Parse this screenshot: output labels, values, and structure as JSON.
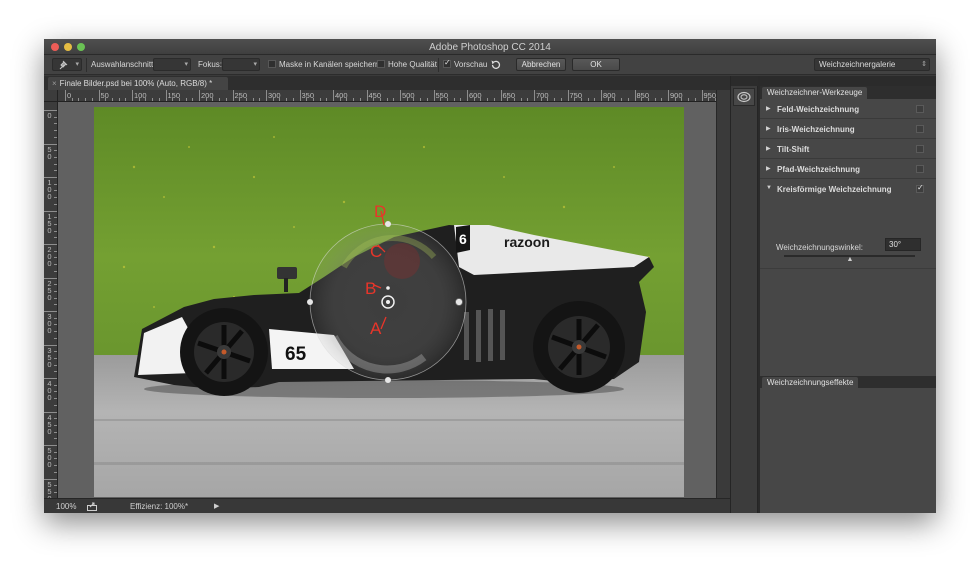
{
  "window": {
    "title": "Adobe Photoshop CC 2014"
  },
  "options_bar": {
    "auswahl_label": "Auswahlanschnitt:",
    "fokus_label": "Fokus:",
    "maske_label": "Maske in Kanälen speichern",
    "maske_checked": false,
    "hohe_label": "Hohe Qualität",
    "hohe_checked": false,
    "vorschau_label": "Vorschau",
    "vorschau_checked": true,
    "abbrechen_label": "Abbrechen",
    "ok_label": "OK",
    "galerie_value": "Weichzeichnergalerie"
  },
  "document": {
    "tab_title": "Finale Bilder.psd bei 100% (Auto, RGB/8) *",
    "close_glyph": "×",
    "h_ruler": [
      "0",
      "50",
      "100",
      "150",
      "200",
      "250",
      "300",
      "350",
      "400",
      "450",
      "500",
      "550",
      "600",
      "650",
      "700",
      "750",
      "800",
      "850",
      "900",
      "950"
    ],
    "v_ruler": [
      "0",
      "50",
      "100",
      "150",
      "200",
      "250",
      "300",
      "350",
      "400",
      "450",
      "500",
      "550"
    ]
  },
  "canvas": {
    "pin_labels": [
      "D",
      "C",
      "B",
      "A"
    ],
    "car_number": "65",
    "car_side_number": "6",
    "sponsor": "razoon"
  },
  "status": {
    "zoom": "100%",
    "efficiency": "Effizienz: 100%*"
  },
  "blur_tools": {
    "tab": "Weichzeichner-Werkzeuge",
    "items": [
      {
        "label": "Feld-Weichzeichnung",
        "checked": false,
        "expanded": false
      },
      {
        "label": "Iris-Weichzeichnung",
        "checked": false,
        "expanded": false
      },
      {
        "label": "Tilt-Shift",
        "checked": false,
        "expanded": false
      },
      {
        "label": "Pfad-Weichzeichnung",
        "checked": false,
        "expanded": false
      },
      {
        "label": "Kreisförmige Weichzeichnung",
        "checked": true,
        "expanded": true
      }
    ],
    "param_label": "Weichzeichnungswinkel:",
    "param_value": "30°",
    "slider_fraction": 0.5
  },
  "effects": {
    "tab": "Weichzeichnungseffekte"
  },
  "colors": {
    "ui_dark": "#3a3a3a",
    "pin_red": "#e8352a",
    "grass": "#6f9a2f",
    "asphalt": "#a9a9a9"
  }
}
